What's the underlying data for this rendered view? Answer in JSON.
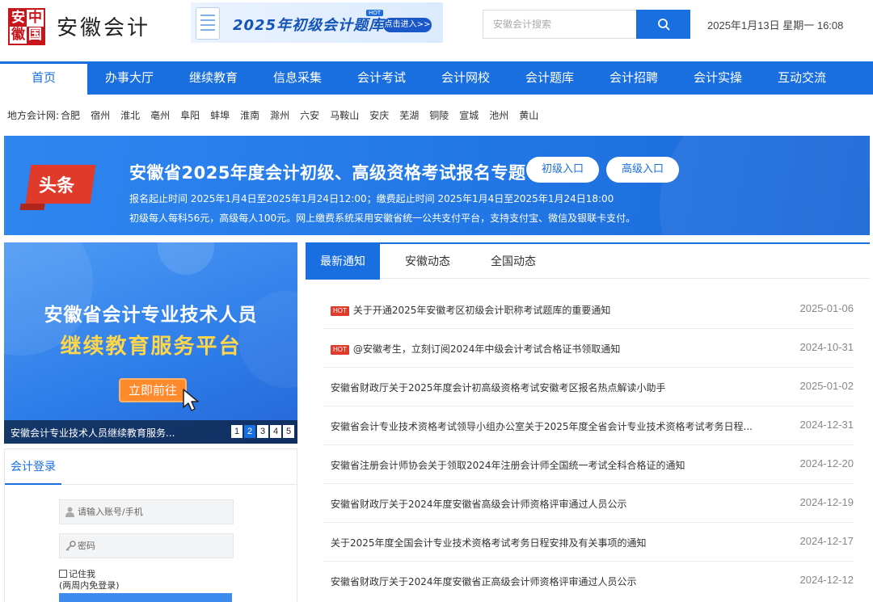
{
  "header": {
    "logo_seal_chars": [
      "安",
      "中",
      "徽",
      "国"
    ],
    "site_name": "安徽会计",
    "ad_title": "2025年初级会计题库",
    "ad_hot": "HOT",
    "ad_button": "点击进入>>",
    "search_placeholder": "安徽会计搜索",
    "datetime": "2025年1月13日 星期一 16:08"
  },
  "nav": {
    "items": [
      {
        "label": "首页",
        "active": true
      },
      {
        "label": "办事大厅"
      },
      {
        "label": "继续教育"
      },
      {
        "label": "信息采集"
      },
      {
        "label": "会计考试"
      },
      {
        "label": "会计网校"
      },
      {
        "label": "会计题库"
      },
      {
        "label": "会计招聘"
      },
      {
        "label": "会计实操"
      },
      {
        "label": "互动交流"
      }
    ]
  },
  "locals": {
    "label": "地方会计网:",
    "cities": [
      "合肥",
      "宿州",
      "淮北",
      "亳州",
      "阜阳",
      "蚌埠",
      "淮南",
      "滁州",
      "六安",
      "马鞍山",
      "安庆",
      "芜湖",
      "铜陵",
      "宣城",
      "池州",
      "黄山"
    ]
  },
  "headline": {
    "tag": "头条",
    "title": "安徽省2025年度会计初级、高级资格考试报名专题",
    "btn_primary": "初级入口",
    "btn_senior": "高级入口",
    "line1": "报名起止时间 2025年1月4日至2025年1月24日12:00；缴费起止时间 2025年1月4日至2025年1月24日18:00",
    "line2": "初级每人每科56元，高级每人100元。网上缴费系统采用安徽省统一公共支付平台，支持支付宝、微信及银联卡支付。"
  },
  "slider": {
    "line1": "安徽省会计专业技术人员",
    "line2": "继续教育服务平台",
    "button": "立即前往",
    "caption": "安徽会计专业技术人员继续教育服务...",
    "pages": [
      "1",
      "2",
      "3",
      "4",
      "5"
    ],
    "current_page": 2
  },
  "login": {
    "tab": "会计登录",
    "account_placeholder": "请输入账号/手机",
    "password_placeholder": "密码",
    "remember": "记住我",
    "remember_note": "(两周内免登录)"
  },
  "news": {
    "tabs": [
      "最新通知",
      "安徽动态",
      "全国动态"
    ],
    "hot_label": "HOT",
    "items": [
      {
        "title": "关于开通2025年安徽考区初级会计职称考试题库的重要通知",
        "date": "2025-01-06",
        "hot": true
      },
      {
        "title": "@安徽考生，立刻订阅2024年中级会计考试合格证书领取通知",
        "date": "2024-10-31",
        "hot": true
      },
      {
        "title": "安徽省财政厅关于2025年度会计初高级资格考试安徽考区报名热点解读小助手",
        "date": "2025-01-02"
      },
      {
        "title": "安徽省会计专业技术资格考试领导小组办公室关于2025年度全省会计专业技术资格考试考务日程...",
        "date": "2024-12-31"
      },
      {
        "title": "安徽省注册会计师协会关于领取2024年注册会计师全国统一考试全科合格证的通知",
        "date": "2024-12-20"
      },
      {
        "title": "安徽省财政厅关于2024年度安徽省高级会计师资格评审通过人员公示",
        "date": "2024-12-19"
      },
      {
        "title": "关于2025年度全国会计专业技术资格考试考务日程安排及有关事项的通知",
        "date": "2024-12-17"
      },
      {
        "title": "安徽省财政厅关于2024年度安徽省正高级会计师资格评审通过人员公示",
        "date": "2024-12-12"
      }
    ]
  },
  "colors": {
    "brand_blue": "#1a6fe0",
    "hot_red": "#e03a2b",
    "seal_red": "#c8161d",
    "accent_yellow": "#ffd64a"
  }
}
